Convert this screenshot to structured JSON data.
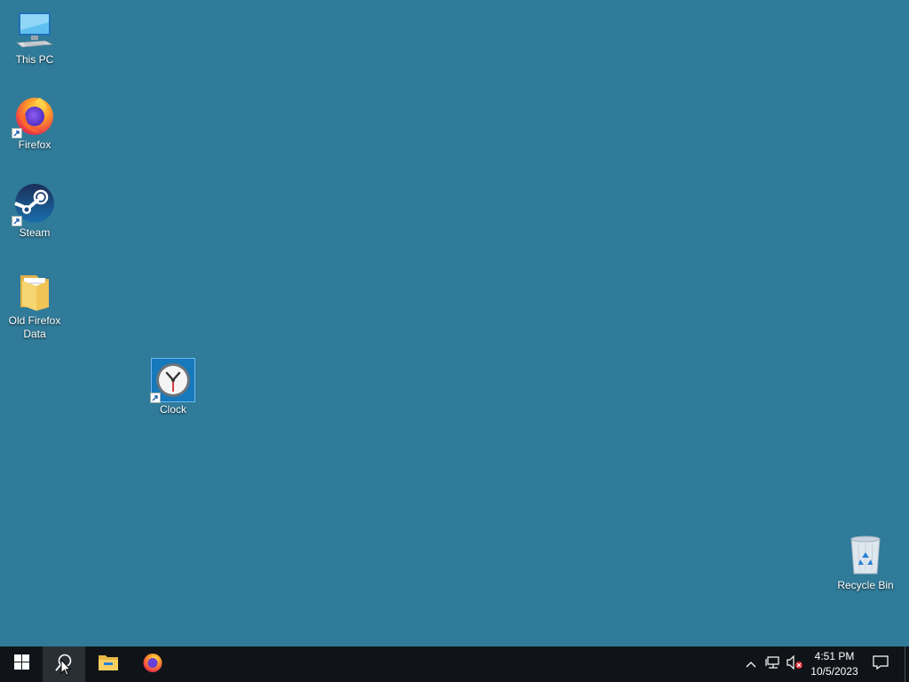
{
  "desktop": {
    "icons": [
      {
        "label": "This PC"
      },
      {
        "label": "Firefox"
      },
      {
        "label": "Steam"
      },
      {
        "label": "Old Firefox Data"
      },
      {
        "label": "Clock"
      },
      {
        "label": "Recycle Bin"
      }
    ]
  },
  "taskbar": {
    "start_icon": "windows-logo-icon",
    "search_icon": "search-icon",
    "pinned": [
      "file-explorer-icon",
      "firefox-icon"
    ],
    "tray": {
      "chevron_icon": "chevron-up-icon",
      "network_icon": "network-icon",
      "volume_icon": "volume-muted-icon",
      "time": "4:51 PM",
      "date": "10/5/2023",
      "notification_icon": "notification-icon"
    }
  },
  "colors": {
    "desktop_background": "#2f7b99",
    "taskbar": "#101418",
    "selection": "#0078d7"
  }
}
